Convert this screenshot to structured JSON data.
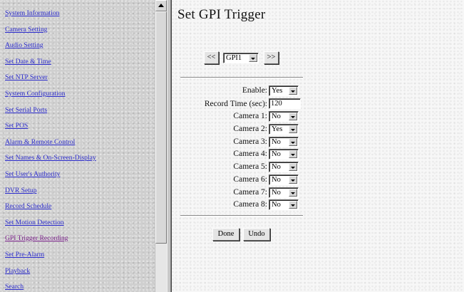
{
  "nav": {
    "links": [
      {
        "label": "System Information"
      },
      {
        "label": "Camera Setting"
      },
      {
        "label": "Audio Setting"
      },
      {
        "label": "Set Date & Time"
      },
      {
        "label": "Set NTP Server"
      },
      {
        "label": "System Configuration"
      },
      {
        "label": "Set Serial Ports"
      },
      {
        "label": "Set POS"
      },
      {
        "label": "Alarm & Remote Control"
      },
      {
        "label": "Set Names & On-Screen-Display"
      },
      {
        "label": "Set User's Authority"
      },
      {
        "label": "DVR Setup"
      },
      {
        "label": "Record Schedule"
      },
      {
        "label": "Set Motion Detection"
      },
      {
        "label": "GPI Trigger Recording"
      },
      {
        "label": "Set Pre-Alarm"
      },
      {
        "label": "Playback"
      },
      {
        "label": "Search"
      }
    ],
    "active_link": "GPI Trigger Recording"
  },
  "main": {
    "title": "Set GPI Trigger",
    "prev_label": "<<",
    "next_label": ">>",
    "gpi_select": "GPI1",
    "enable": {
      "label": "Enable:",
      "value": "Yes"
    },
    "record_time": {
      "label": "Record Time (sec):",
      "value": "120"
    },
    "cameras": [
      {
        "label": "Camera 1:",
        "value": "No"
      },
      {
        "label": "Camera 2:",
        "value": "Yes"
      },
      {
        "label": "Camera 3:",
        "value": "No"
      },
      {
        "label": "Camera 4:",
        "value": "No"
      },
      {
        "label": "Camera 5:",
        "value": "No"
      },
      {
        "label": "Camera 6:",
        "value": "No"
      },
      {
        "label": "Camera 7:",
        "value": "No"
      },
      {
        "label": "Camera 8:",
        "value": "No"
      }
    ],
    "done_label": "Done",
    "undo_label": "Undo"
  },
  "colors": {
    "link": "#2a2acc",
    "visited_link": "#7a1f8a",
    "nav_background": "#cfcfcf",
    "main_background": "#f7f7f7"
  },
  "icons": {
    "scroll_up": "triangle-up-icon",
    "dropdown": "triangle-down-icon"
  }
}
